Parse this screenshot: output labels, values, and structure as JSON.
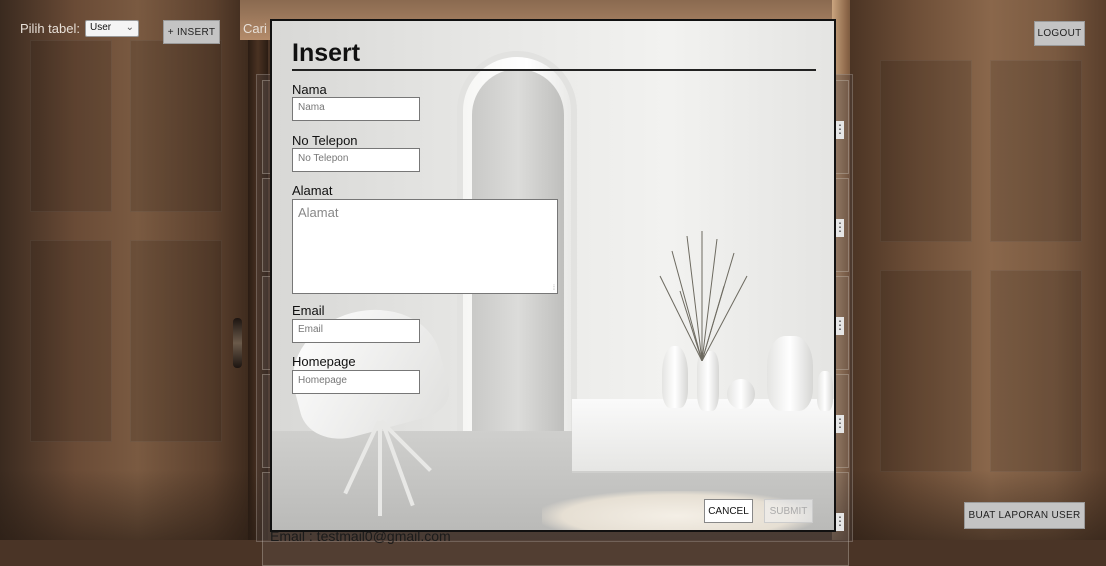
{
  "topbar": {
    "table_label": "Pilih tabel:",
    "table_select_value": "User",
    "insert_button": "+ INSERT",
    "search_label": "Cari",
    "logout_button": "LOGOUT"
  },
  "background": {
    "email_text": "Email : testmail0@gmail.com",
    "card_menu_icon": "⋮"
  },
  "report_button": "BUAT LAPORAN USER",
  "modal": {
    "title": "Insert",
    "fields": [
      {
        "label": "Nama",
        "placeholder": "Nama"
      },
      {
        "label": "No Telepon",
        "placeholder": "No Telepon"
      },
      {
        "label": "Alamat",
        "placeholder": "Alamat"
      },
      {
        "label": "Email",
        "placeholder": "Email"
      },
      {
        "label": "Homepage",
        "placeholder": "Homepage"
      }
    ],
    "cancel_button": "CANCEL",
    "submit_button": "SUBMIT"
  }
}
